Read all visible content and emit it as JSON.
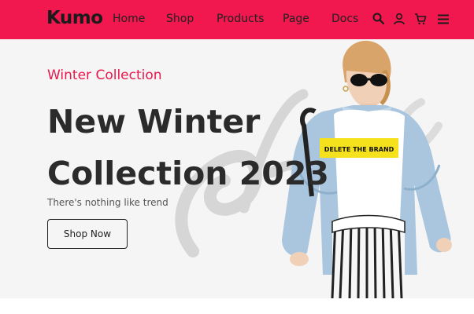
{
  "brand": {
    "name": "Kumo"
  },
  "nav": {
    "items": [
      {
        "label": "Home"
      },
      {
        "label": "Shop"
      },
      {
        "label": "Products"
      },
      {
        "label": "Page"
      },
      {
        "label": "Docs"
      }
    ],
    "icons": [
      "search-icon",
      "user-icon",
      "cart-icon",
      "menu-icon"
    ]
  },
  "hero": {
    "eyebrow": "Winter Collection",
    "headline_line1": "New Winter",
    "headline_line2": "Collection 2023",
    "subtitle": "There's nothing like trend",
    "cta_label": "Shop Now",
    "tshirt_print": "DELETE THE BRAND"
  },
  "colors": {
    "navbar": "#f0184e",
    "accent": "#e8174c",
    "hero_bg": "#f5f5f5",
    "text_dark": "#2b2b2b"
  }
}
